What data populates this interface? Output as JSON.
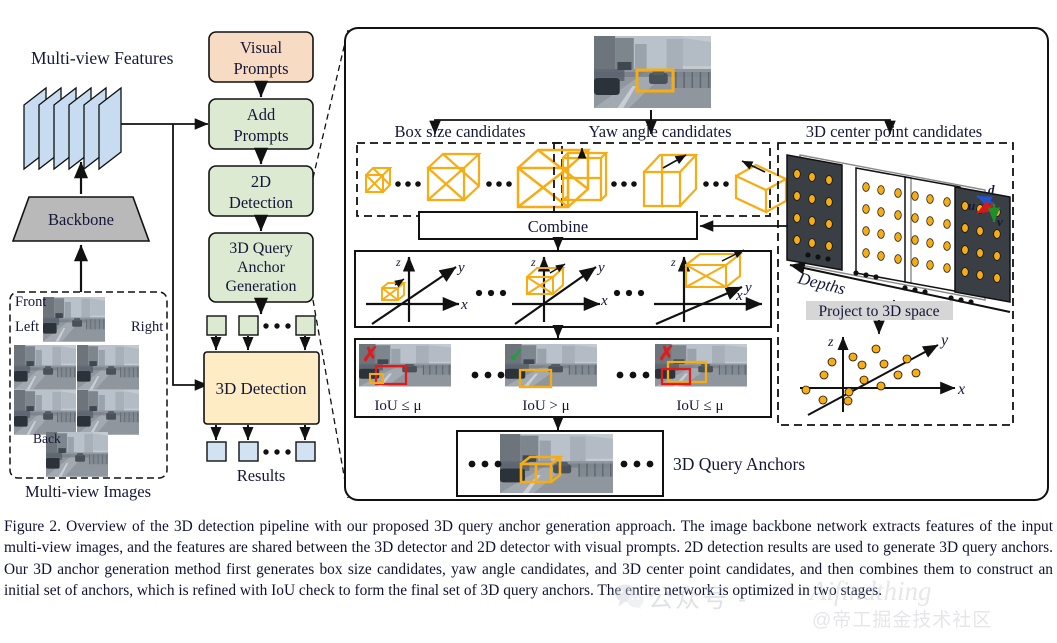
{
  "figure": {
    "label": "Figure 2.",
    "caption": "Figure 2. Overview of the 3D detection pipeline with our proposed 3D query anchor generation approach. The image backbone network extracts features of the input multi-view images, and the features are shared between the 3D detector and 2D detector with visual prompts. 2D detection results are used to generate 3D query anchors. Our 3D anchor generation method first generates box size candidates, yaw angle candidates, and 3D center point candidates, and then combines them to construct an initial set of anchors, which is refined with IoU check to form the final set of 3D query anchors. The entire network is optimized in two stages."
  },
  "left_pipeline": {
    "features_title": "Multi-view Features",
    "backbone_label": "Backbone",
    "images_panel": {
      "caption": "Multi-view Images",
      "views": [
        "Front",
        "Left",
        "Right",
        "Back"
      ]
    },
    "blocks": [
      {
        "id": "visual-prompts",
        "label_lines": [
          "Visual",
          "Prompts"
        ],
        "color": "#f8dbc3"
      },
      {
        "id": "add-prompts",
        "label_lines": [
          "Add",
          "Prompts"
        ],
        "color": "#dcead2"
      },
      {
        "id": "2d-detection",
        "label_lines": [
          "2D",
          "Detection"
        ],
        "color": "#dcead2"
      },
      {
        "id": "3d-query-anchor-generation",
        "label_lines": [
          "3D Query",
          "Anchor",
          "Generation"
        ],
        "color": "#dcead2"
      },
      {
        "id": "3d-detection",
        "label_lines": [
          "3D Detection"
        ],
        "color": "#fdecc4"
      }
    ],
    "results_label": "Results",
    "ellipsis": "• • •"
  },
  "main_panel": {
    "candidate_groups": [
      {
        "id": "box-size",
        "title": "Box size candidates"
      },
      {
        "id": "yaw-angle",
        "title": "Yaw angle candidates"
      },
      {
        "id": "center-point",
        "title": "3D center point candidates"
      }
    ],
    "combine_label": "Combine",
    "depths_label": "Depths",
    "project_label": "Project to 3D space",
    "axis_labels_3d": [
      "x",
      "y",
      "z"
    ],
    "uvd_labels": [
      "d",
      "u",
      "v"
    ],
    "iou_labels": [
      "IoU ≤ μ",
      "IoU > μ",
      "IoU ≤ μ"
    ],
    "iou_marks": [
      "✗",
      "✓",
      "✗"
    ],
    "anchors_label": "3D Query Anchors",
    "ellipsis": "• • •"
  },
  "colors": {
    "prompt_peach": "#f8dbc3",
    "block_green": "#dcead2",
    "block_cream": "#fdecc4",
    "feature_blue": "#c7dcf0",
    "result_blue": "#d3e2f2",
    "anchor_orange": "#f7ac13",
    "check_green": "#1e9e3e",
    "cross_red": "#e01b1b",
    "stroke_black": "#111111",
    "grey_fill": "#b9b9b9"
  },
  "watermark": {
    "cn": "公众号 -",
    "en": "Aifindthing",
    "sub": "@帝工掘金技术社区"
  }
}
